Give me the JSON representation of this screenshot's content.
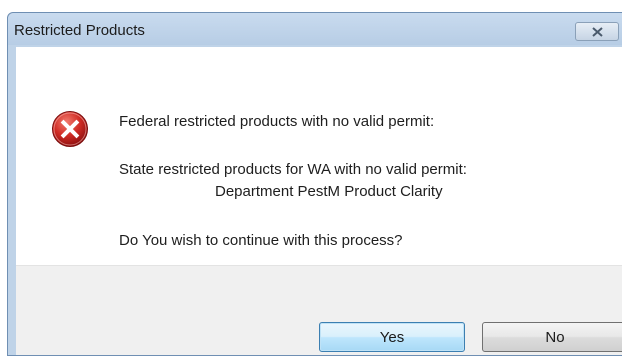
{
  "dialog": {
    "title": "Restricted Products",
    "close_icon": "close-x-icon",
    "error_icon": "error-circle-x-icon",
    "colors": {
      "error_red": "#cc2a2a",
      "button_focus_border": "#3c7fb1"
    }
  },
  "message": {
    "line1": "Federal restricted products with no valid permit:",
    "line2": "State restricted products for WA with no valid permit:",
    "line3": "Department PestM Product Clarity",
    "line4": "Do You wish to continue with this process?"
  },
  "buttons": {
    "yes_label": "Yes",
    "no_label": "No"
  }
}
